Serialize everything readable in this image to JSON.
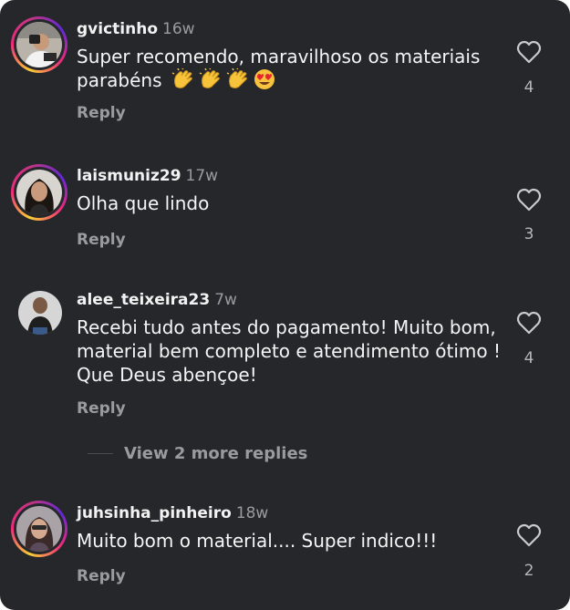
{
  "reply_label": "Reply",
  "view_more_replies": "View 2 more replies",
  "colors": {
    "background": "#26272b",
    "text": "#f5f5f5",
    "muted": "#9a9ba0"
  },
  "comments": [
    {
      "username": "gvictinho",
      "time": "16w",
      "text": "Super recomendo, maravilhoso os materiais parabéns",
      "emojis": [
        "clapping-hands",
        "clapping-hands",
        "clapping-hands",
        "heart-eyes"
      ],
      "likes": "4",
      "story_ring": true
    },
    {
      "username": "laismuniz29",
      "time": "17w",
      "text": "Olha que lindo",
      "likes": "3",
      "story_ring": true
    },
    {
      "username": "alee_teixeira23",
      "time": "7w",
      "text": "Recebi tudo antes do pagamento! Muito bom, material bem completo e atendimento ótimo ! Que Deus abençoe!",
      "likes": "4",
      "story_ring": false
    },
    {
      "username": "juhsinha_pinheiro",
      "time": "18w",
      "text": "Muito bom o material.... Super indico!!!",
      "likes": "2",
      "story_ring": true
    }
  ]
}
